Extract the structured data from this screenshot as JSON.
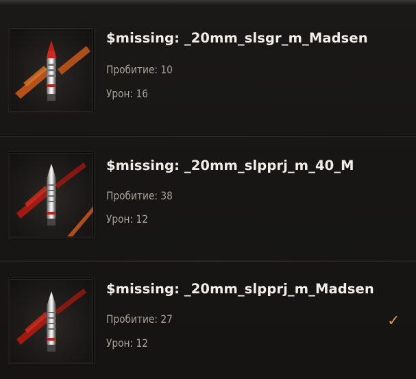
{
  "shells": [
    {
      "name": "$missing: _20mm_slsgr_m_Madsen",
      "penetration_label": "Пробитие: 10",
      "damage_label": "Урон: 16",
      "selected": false,
      "icon": "ammo-he-shell-icon"
    },
    {
      "name": "$missing: _20mm_slpprj_m_40_M",
      "penetration_label": "Пробитие: 38",
      "damage_label": "Урон: 12",
      "selected": false,
      "icon": "ammo-ap-shell-icon"
    },
    {
      "name": "$missing: _20mm_slpprj_m_Madsen",
      "penetration_label": "Пробитие: 27",
      "damage_label": "Урон: 12",
      "selected": true,
      "icon": "ammo-ap-shell-icon"
    }
  ],
  "selected_mark": "✓",
  "colors": {
    "accent_check": "#d89a3a",
    "title": "#f2efe9",
    "stat": "#a8a39a",
    "stripe_red": "#b01a10",
    "stripe_orange": "#c8581a"
  }
}
